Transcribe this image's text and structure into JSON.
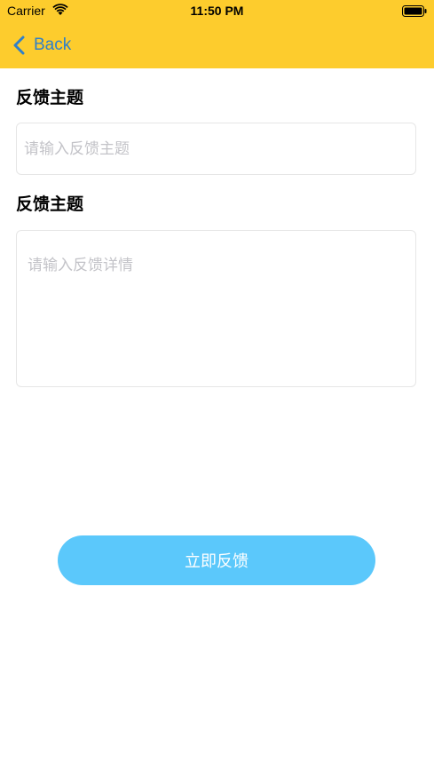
{
  "status_bar": {
    "carrier": "Carrier",
    "time": "11:50 PM"
  },
  "nav": {
    "back_label": "Back"
  },
  "form": {
    "subject_label": "反馈主题",
    "subject_placeholder": "请输入反馈主题",
    "detail_label": "反馈主题",
    "detail_placeholder": "请输入反馈详情",
    "submit_label": "立即反馈"
  },
  "colors": {
    "header_bg": "#fdcc2d",
    "back_tint": "#2f80c9",
    "button_bg": "#5bc8fb"
  }
}
